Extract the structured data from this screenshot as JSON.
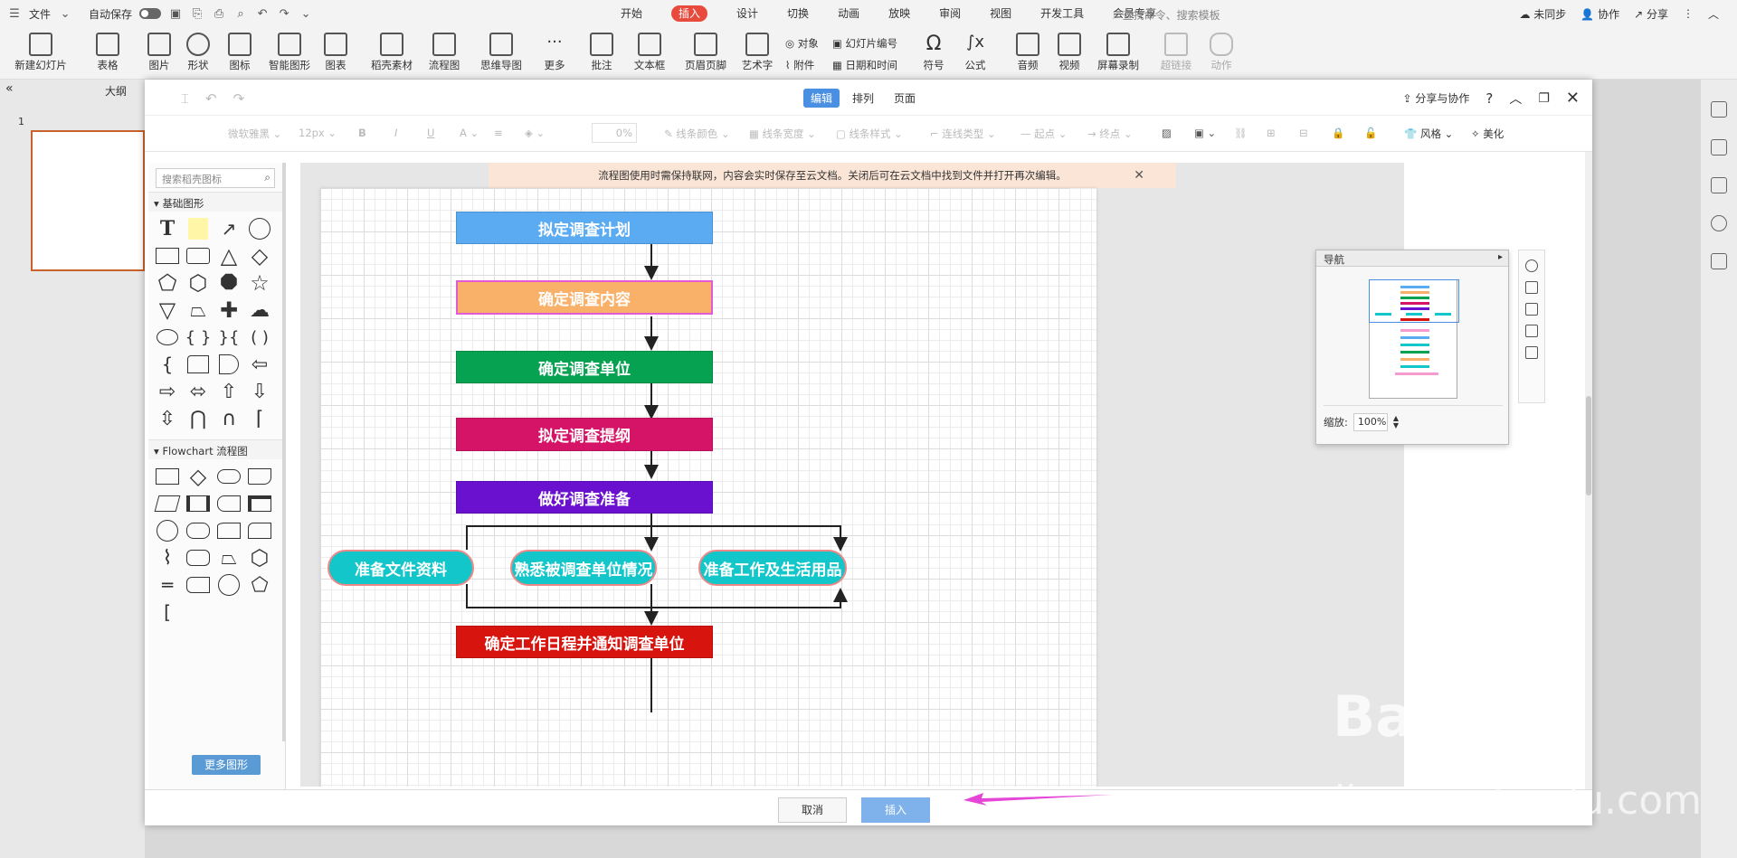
{
  "titlebar": {
    "file_menu": "文件",
    "autosave_label": "自动保存",
    "tabs": [
      "开始",
      "插入",
      "设计",
      "切换",
      "动画",
      "放映",
      "审阅",
      "视图",
      "开发工具",
      "会员专享"
    ],
    "active_tab": "插入",
    "search_placeholder": "查找命令、搜索模板",
    "right": [
      "未同步",
      "协作",
      "分享"
    ]
  },
  "ribbon": {
    "items": [
      "新建幻灯片",
      "表格",
      "图片",
      "形状",
      "图标",
      "智能图形",
      "图表",
      "稻壳素材",
      "流程图",
      "思维导图",
      "更多",
      "批注",
      "文本框",
      "页眉页脚",
      "艺术字",
      "符号",
      "公式",
      "音频",
      "视频",
      "屏幕录制",
      "超链接",
      "动作"
    ],
    "small": [
      "对象",
      "幻灯片编号",
      "附件",
      "日期和时间"
    ]
  },
  "left_panel": {
    "outline": "大纲",
    "slide_number": "1"
  },
  "dialog": {
    "tabs": [
      "编辑",
      "排列",
      "页面"
    ],
    "active_tab": "编辑",
    "share": "分享与协作",
    "format": {
      "font": "微软雅黑",
      "size": "12px",
      "bold": "B",
      "italic": "I",
      "underline": "U",
      "font_color": "A",
      "opacity": "0%",
      "line_color": "线条颜色",
      "line_width": "线条宽度",
      "line_style": "线条样式",
      "connector": "连线类型",
      "start": "起点",
      "end": "终点",
      "style": "风格",
      "beautify": "美化"
    },
    "shape_search_placeholder": "搜索稻壳图标",
    "sections": {
      "basic": "基础图形",
      "flowchart": "Flowchart 流程图"
    },
    "more_shapes": "更多图形",
    "notice": "流程图使用时需保持联网，内容会实时保存至云文档。关闭后可在云文档中找到文件并打开再次编辑。",
    "nodes": [
      {
        "text": "拟定调查计划",
        "color": "#5aabf2"
      },
      {
        "text": "确定调查内容",
        "color": "#f9b169"
      },
      {
        "text": "确定调查单位",
        "color": "#07a152"
      },
      {
        "text": "拟定调查提纲",
        "color": "#d51467"
      },
      {
        "text": "做好调查准备",
        "color": "#6a10cf"
      },
      {
        "text": "准备文件资料",
        "color": "#13c6c9"
      },
      {
        "text": "熟悉被调查单位情况",
        "color": "#13c6c9"
      },
      {
        "text": "准备工作及生活用品",
        "color": "#13c6c9"
      },
      {
        "text": "确定工作日程并通知调查单位",
        "color": "#d8140f"
      }
    ],
    "navigator": {
      "title": "导航",
      "zoom_label": "缩放:",
      "zoom_value": "100%"
    },
    "buttons": {
      "cancel": "取消",
      "insert": "插入"
    }
  },
  "watermark": {
    "brand": "Bai 经验",
    "url": "jingyan.baidu.com"
  }
}
